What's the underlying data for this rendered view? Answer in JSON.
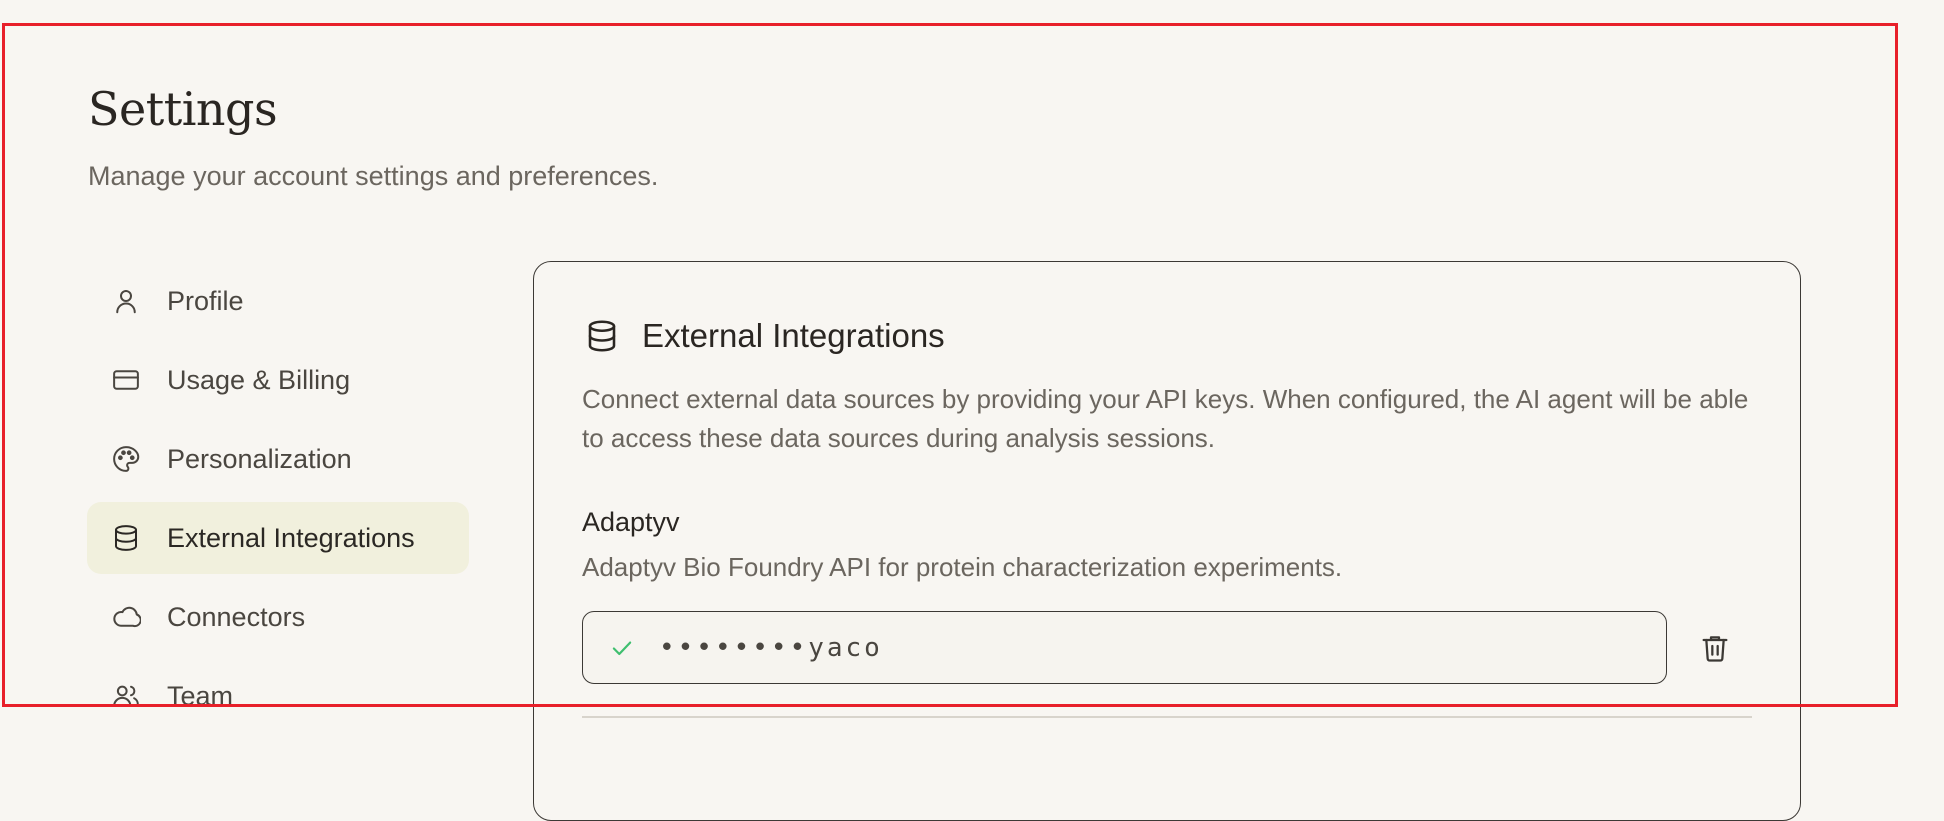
{
  "header": {
    "title": "Settings",
    "subtitle": "Manage your account settings and preferences."
  },
  "sidebar": {
    "items": [
      {
        "label": "Profile",
        "icon": "user-icon",
        "active": false
      },
      {
        "label": "Usage & Billing",
        "icon": "credit-card-icon",
        "active": false
      },
      {
        "label": "Personalization",
        "icon": "palette-icon",
        "active": false
      },
      {
        "label": "External Integrations",
        "icon": "database-icon",
        "active": true
      },
      {
        "label": "Connectors",
        "icon": "cloud-icon",
        "active": false
      },
      {
        "label": "Team",
        "icon": "users-icon",
        "active": false
      }
    ]
  },
  "panel": {
    "icon": "database-icon",
    "title": "External Integrations",
    "description": "Connect external data sources by providing your API keys. When configured, the AI agent will be able to access these data sources during analysis sessions.",
    "integrations": [
      {
        "name": "Adaptyv",
        "description": "Adaptyv Bio Foundry API for protein characterization experiments.",
        "key_value": "••••••••yaco",
        "status_icon": "check-icon",
        "delete_icon": "trash-icon"
      }
    ]
  },
  "colors": {
    "background": "#f8f6f2",
    "active_nav": "#f1f0dd",
    "check": "#3fbf6f",
    "highlight_frame": "#e8202a"
  }
}
